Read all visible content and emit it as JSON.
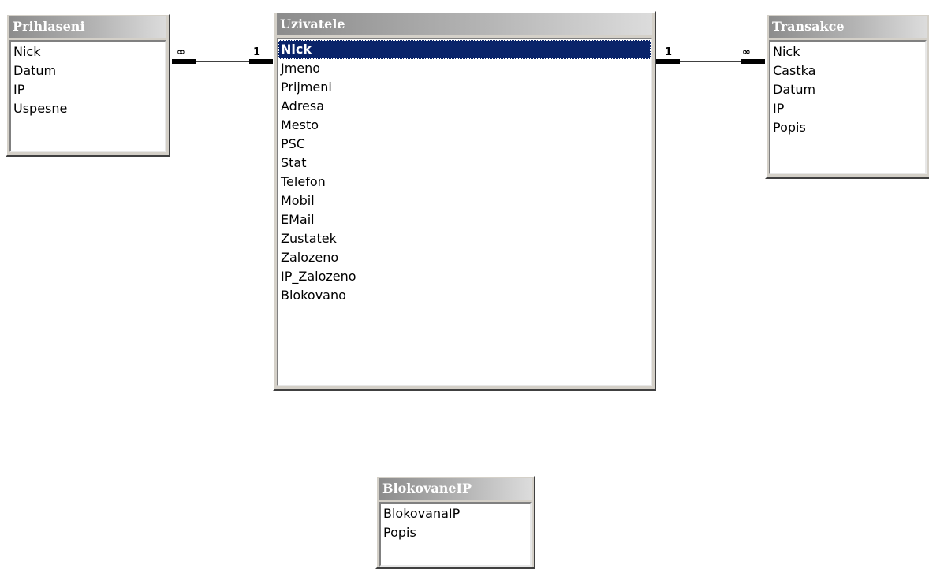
{
  "tables": [
    {
      "id": "prihlaseni",
      "title": "Prihlaseni",
      "fields": [
        "Nick",
        "Datum",
        "IP",
        "Uspesne"
      ],
      "selected": null
    },
    {
      "id": "uzivatele",
      "title": "Uzivatele",
      "fields": [
        "Nick",
        "Jmeno",
        "Prijmeni",
        "Adresa",
        "Mesto",
        "PSC",
        "Stat",
        "Telefon",
        "Mobil",
        "EMail",
        "Zustatek",
        "Zalozeno",
        "IP_Zalozeno",
        "Blokovano"
      ],
      "selected": "Nick"
    },
    {
      "id": "transakce",
      "title": "Transakce",
      "fields": [
        "Nick",
        "Castka",
        "Datum",
        "IP",
        "Popis"
      ],
      "selected": null
    },
    {
      "id": "blokovaneip",
      "title": "BlokovaneIP",
      "fields": [
        "BlokovanaIP",
        "Popis"
      ],
      "selected": null
    }
  ],
  "relationships": [
    {
      "from": "Uzivatele.Nick",
      "to": "Prihlaseni.Nick",
      "one": "1",
      "many": "∞"
    },
    {
      "from": "Uzivatele.Nick",
      "to": "Transakce.Nick",
      "one": "1",
      "many": "∞"
    }
  ]
}
